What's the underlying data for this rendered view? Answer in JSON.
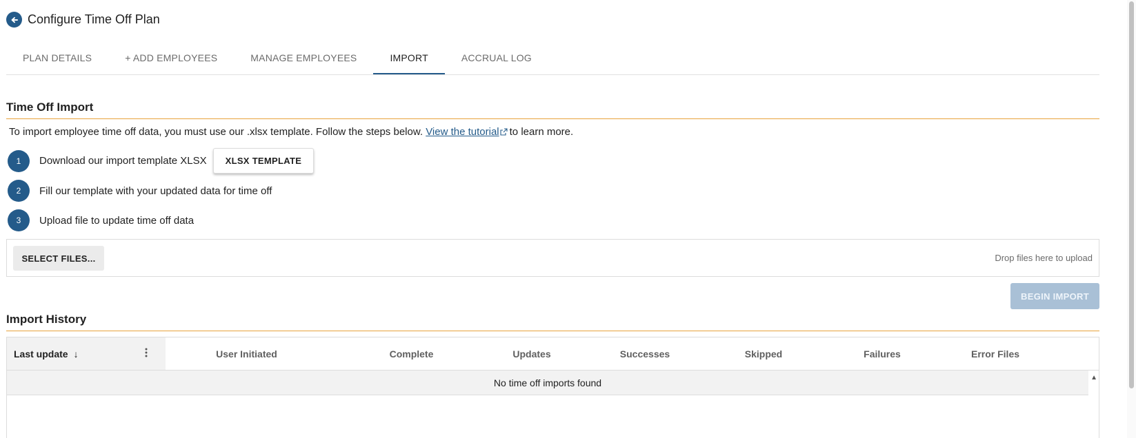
{
  "header": {
    "title": "Configure Time Off Plan",
    "back_icon": "arrow-left-icon"
  },
  "tabs": [
    {
      "label": "PLAN DETAILS",
      "active": false
    },
    {
      "label": "+ ADD EMPLOYEES",
      "active": false
    },
    {
      "label": "MANAGE EMPLOYEES",
      "active": false
    },
    {
      "label": "IMPORT",
      "active": true
    },
    {
      "label": "ACCRUAL LOG",
      "active": false
    }
  ],
  "import": {
    "title": "Time Off Import",
    "intro_prefix": "To import employee time off data, you must use our .xlsx template. Follow the steps below.",
    "tutorial_link": "View the tutorial",
    "intro_suffix": "to learn more.",
    "steps": [
      {
        "num": "1",
        "text": "Download our import template XLSX",
        "button": "XLSX TEMPLATE"
      },
      {
        "num": "2",
        "text": "Fill our template with your updated data for time off"
      },
      {
        "num": "3",
        "text": "Upload file to update time off data"
      }
    ],
    "select_files": "SELECT FILES...",
    "drop_hint": "Drop files here to upload",
    "begin_import": "BEGIN IMPORT"
  },
  "history": {
    "title": "Import History",
    "columns": [
      "Last update",
      "User Initiated",
      "Complete",
      "Updates",
      "Successes",
      "Skipped",
      "Failures",
      "Error Files"
    ],
    "sort_indicator": "↓",
    "no_rows": "No time off imports found"
  },
  "colors": {
    "primary": "#245b8a",
    "accent_rule": "#e8a13a",
    "disabled_button": "#a9c0d6"
  }
}
